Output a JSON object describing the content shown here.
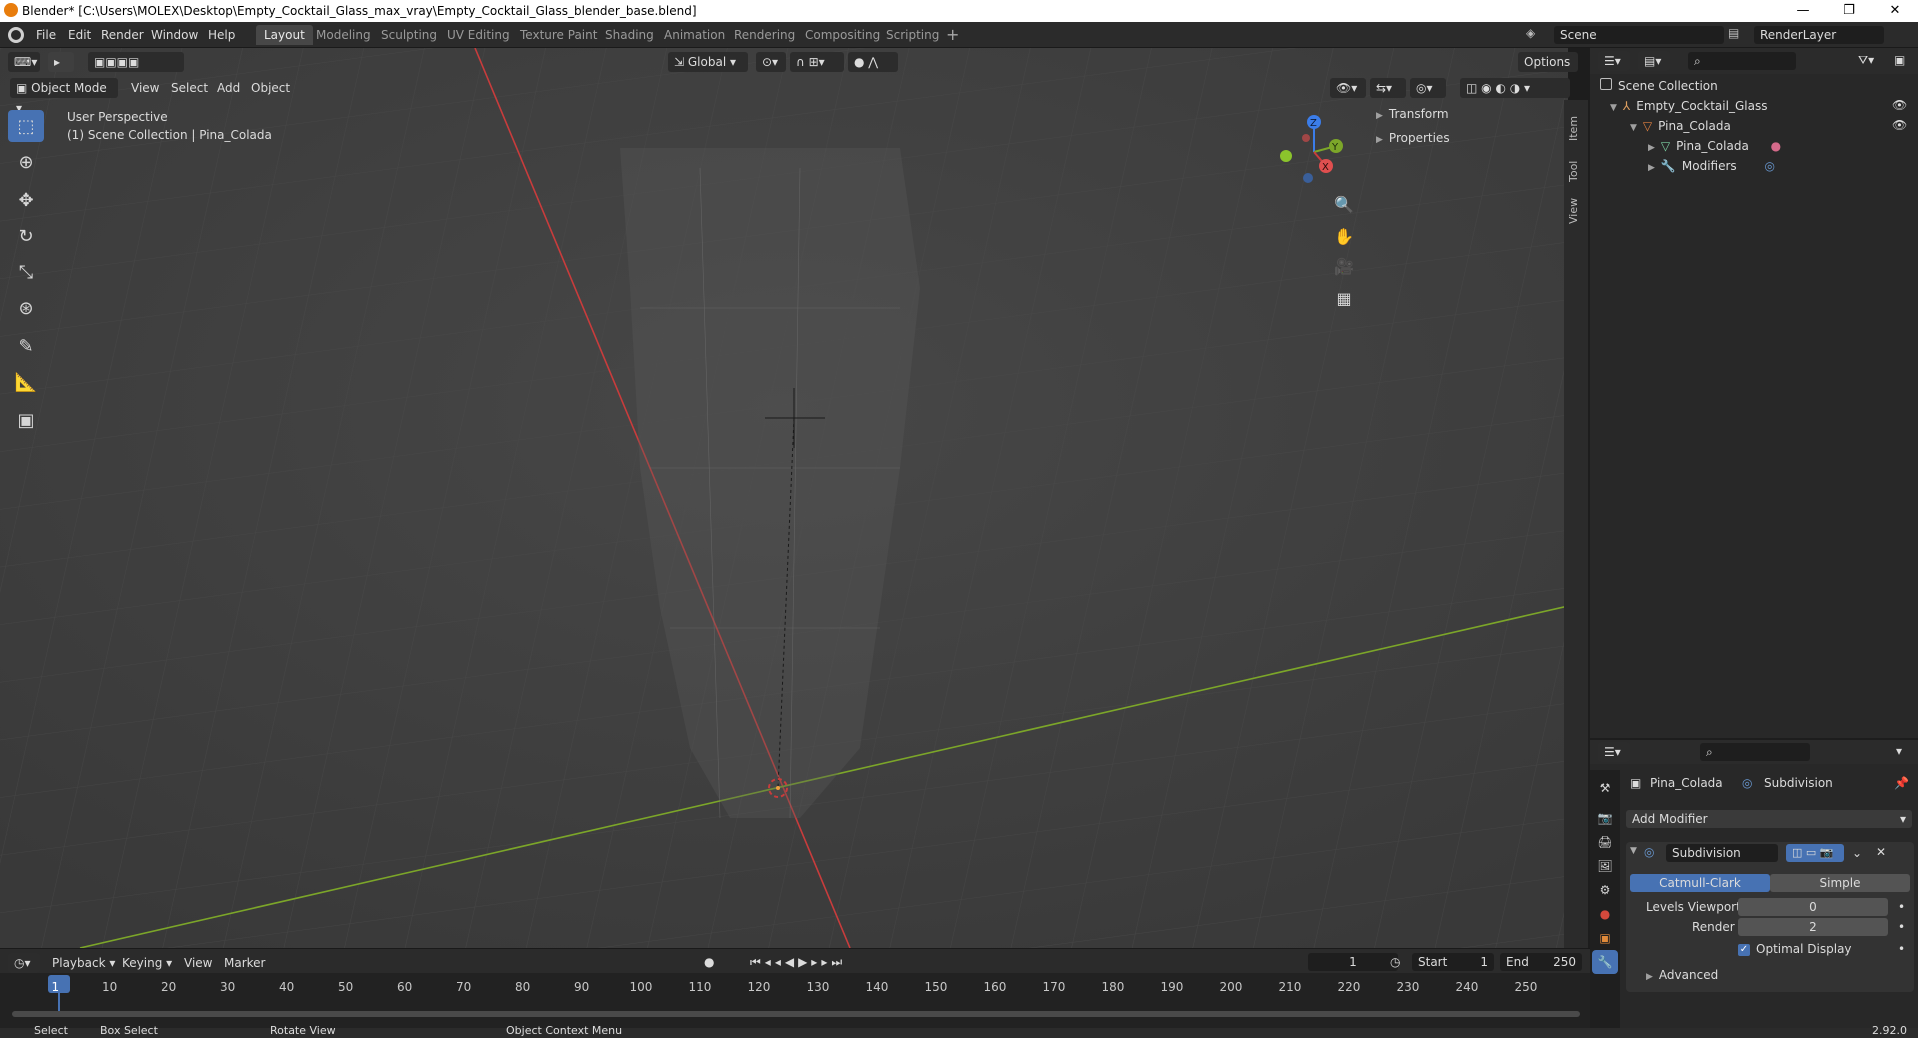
{
  "window": {
    "title": "Blender* [C:\\Users\\MOLEX\\Desktop\\Empty_Cocktail_Glass_max_vray\\Empty_Cocktail_Glass_blender_base.blend]",
    "buttons": [
      "—",
      "❐",
      "✕"
    ]
  },
  "menus": [
    "File",
    "Edit",
    "Render",
    "Window",
    "Help"
  ],
  "workspaces": [
    "Layout",
    "Modeling",
    "Sculpting",
    "UV Editing",
    "Texture Paint",
    "Shading",
    "Animation",
    "Rendering",
    "Compositing",
    "Scripting"
  ],
  "active_workspace": "Layout",
  "scene": {
    "label": "Scene",
    "render_layer": "RenderLayer"
  },
  "viewport": {
    "mode": "Object Mode",
    "menu": [
      "View",
      "Select",
      "Add",
      "Object"
    ],
    "orientation": "Global",
    "options_label": "Options",
    "overlay_text_1": "User Perspective",
    "overlay_text_2": "(1) Scene Collection | Pina_Colada",
    "side_tabs": [
      "Item",
      "Tool",
      "View"
    ],
    "npanel": [
      "Transform",
      "Properties"
    ],
    "gizmo": {
      "z": "Z",
      "y": "Y",
      "x": "X"
    }
  },
  "outliner": {
    "root": "Scene Collection",
    "items": [
      {
        "label": "Empty_Cocktail_Glass",
        "depth": 1
      },
      {
        "label": "Pina_Colada",
        "depth": 2
      },
      {
        "label": "Pina_Colada",
        "depth": 3
      },
      {
        "label": "Modifiers",
        "depth": 3
      }
    ]
  },
  "properties": {
    "object": "Pina_Colada",
    "modifier_tab": "Subdivision",
    "add_modifier": "Add Modifier",
    "modifier_name": "Subdivision",
    "method_a": "Catmull-Clark",
    "method_b": "Simple",
    "levels_viewport_label": "Levels Viewport",
    "levels_viewport_value": "0",
    "render_label": "Render",
    "render_value": "2",
    "optimal_display": "Optimal Display",
    "advanced": "Advanced"
  },
  "timeline": {
    "menus": [
      "Playback",
      "Keying",
      "View",
      "Marker"
    ],
    "current_frame": "1",
    "start_label": "Start",
    "start_value": "1",
    "end_label": "End",
    "end_value": "250",
    "ticks": [
      "1",
      "10",
      "20",
      "30",
      "40",
      "50",
      "60",
      "70",
      "80",
      "90",
      "100",
      "110",
      "120",
      "130",
      "140",
      "150",
      "160",
      "170",
      "180",
      "190",
      "200",
      "210",
      "220",
      "230",
      "240",
      "250"
    ]
  },
  "statusbar": {
    "select": "Select",
    "box_select": "Box Select",
    "rotate": "Rotate View",
    "context": "Object Context Menu",
    "version": "2.92.0"
  },
  "colors": {
    "accent": "#4772b3",
    "x_axis": "#c83c3c",
    "y_axis": "#7ca629"
  }
}
